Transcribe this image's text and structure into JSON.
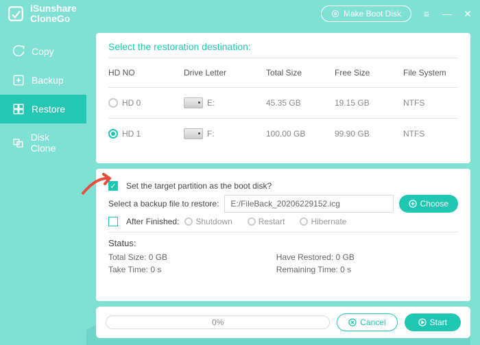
{
  "app": {
    "name": "iSunshare\nCloneGo"
  },
  "titlebar": {
    "make_boot": "Make Boot Disk"
  },
  "sidebar": {
    "items": [
      {
        "label": "Copy"
      },
      {
        "label": "Backup"
      },
      {
        "label": "Restore"
      },
      {
        "label": "Disk Clone"
      }
    ]
  },
  "panel1": {
    "title": "Select the restoration destination:",
    "headers": {
      "hdno": "HD NO",
      "drive": "Drive Letter",
      "total": "Total Size",
      "free": "Free Size",
      "fs": "File System"
    },
    "rows": [
      {
        "hd": "HD 0",
        "letter": "E:",
        "total": "45.35 GB",
        "free": "19.15 GB",
        "fs": "NTFS",
        "selected": false
      },
      {
        "hd": "HD 1",
        "letter": "F:",
        "total": "100.00 GB",
        "free": "99.90 GB",
        "fs": "NTFS",
        "selected": true
      }
    ]
  },
  "panel2": {
    "set_boot_label": "Set the target partition as the boot disk?",
    "select_backup_label": "Select a backup file to restore:",
    "backup_path": "E:/FileBack_20206229152.icg",
    "choose_label": "Choose",
    "after_label": "After Finished:",
    "opts": {
      "shutdown": "Shutdown",
      "restart": "Restart",
      "hibernate": "Hibernate"
    },
    "status_title": "Status:",
    "status": {
      "total": "Total Size: 0 GB",
      "restored": "Have Restored: 0 GB",
      "take": "Take Time: 0 s",
      "remaining": "Remaining Time: 0 s"
    }
  },
  "footer": {
    "progress": "0%",
    "cancel": "Cancel",
    "start": "Start"
  }
}
